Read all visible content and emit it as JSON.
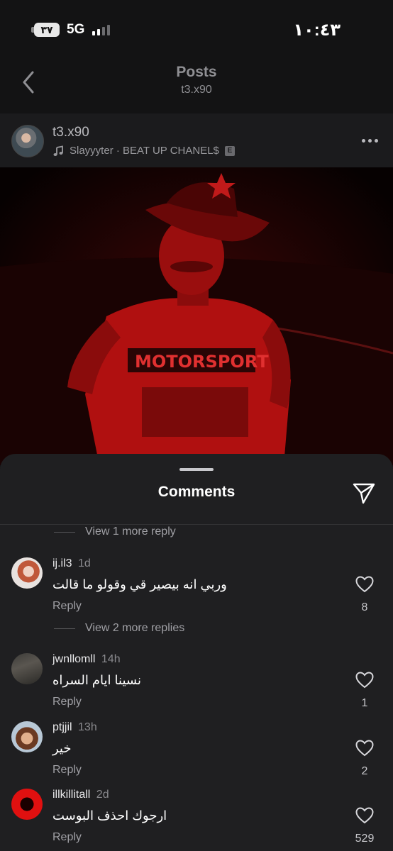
{
  "status_bar": {
    "battery": "٣٧",
    "network": "5G",
    "time": "١٠:٤٣"
  },
  "header": {
    "title": "Posts",
    "subtitle": "t3.x90"
  },
  "post": {
    "username": "t3.x90",
    "music": "Slayyyter · BEAT UP CHANEL$",
    "explicit_badge": "E"
  },
  "comments_sheet": {
    "title": "Comments",
    "view_more_1": "View 1 more reply",
    "view_more_2": "View 2 more replies",
    "comments": [
      {
        "user": "ij.il3",
        "time": "1d",
        "text": "وربي انه بيصير قي وقولو ما قالت",
        "reply": "Reply",
        "likes": "8"
      },
      {
        "user": "jwnllomll",
        "time": "14h",
        "text": "نسينا ايام السراه",
        "reply": "Reply",
        "likes": "1"
      },
      {
        "user": "ptjjil",
        "time": "13h",
        "text": "خير",
        "reply": "Reply",
        "likes": "2"
      },
      {
        "user": "illkillitall",
        "time": "2d",
        "text": "ارجوك احذف البوست",
        "reply": "Reply",
        "likes": "529"
      }
    ]
  },
  "colors": {
    "background": "#131314",
    "sheet": "#1f1f21",
    "photo_tint": "#c0100e"
  },
  "icons": [
    "back-chevron-icon",
    "music-note-icon",
    "more-dots-icon",
    "share-send-icon",
    "heart-icon"
  ]
}
